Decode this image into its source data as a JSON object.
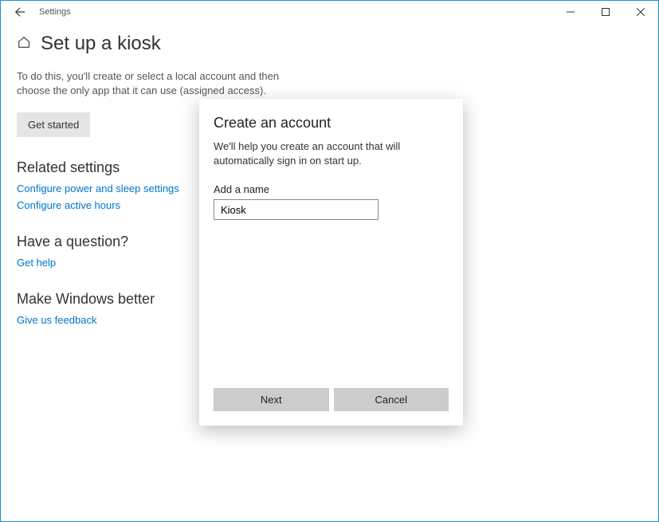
{
  "titlebar": {
    "title": "Settings"
  },
  "page": {
    "title": "Set up a kiosk",
    "description": "To do this, you'll create or select a local account and then choose the only app that it can use (assigned access).",
    "get_started_label": "Get started"
  },
  "related": {
    "heading": "Related settings",
    "link1": "Configure power and sleep settings",
    "link2": "Configure active hours"
  },
  "question": {
    "heading": "Have a question?",
    "link": "Get help"
  },
  "feedback": {
    "heading": "Make Windows better",
    "link": "Give us feedback"
  },
  "dialog": {
    "title": "Create an account",
    "text": "We'll help you create an account that will automatically sign in on start up.",
    "field_label": "Add a name",
    "name_value": "Kiosk",
    "next_label": "Next",
    "cancel_label": "Cancel"
  }
}
